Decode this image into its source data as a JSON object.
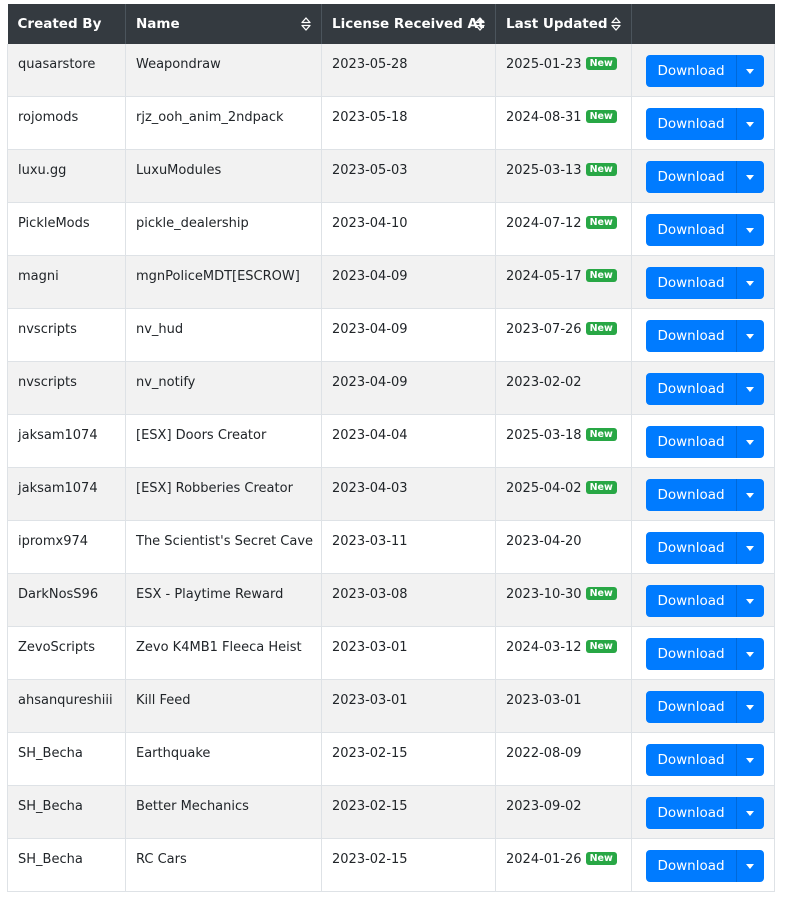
{
  "table": {
    "headers": {
      "created_by": "Created By",
      "name": "Name",
      "license_received_at": "License Received At",
      "last_updated": "Last Updated"
    },
    "new_badge_label": "New",
    "download_label": "Download",
    "rows": [
      {
        "created_by": "quasarstore",
        "name": "Weapondraw",
        "license": "2023-05-28",
        "updated": "2025-01-23",
        "new": true
      },
      {
        "created_by": "rojomods",
        "name": "rjz_ooh_anim_2ndpack",
        "license": "2023-05-18",
        "updated": "2024-08-31",
        "new": true
      },
      {
        "created_by": "luxu.gg",
        "name": "LuxuModules",
        "license": "2023-05-03",
        "updated": "2025-03-13",
        "new": true
      },
      {
        "created_by": "PickleMods",
        "name": "pickle_dealership",
        "license": "2023-04-10",
        "updated": "2024-07-12",
        "new": true
      },
      {
        "created_by": "magni",
        "name": "mgnPoliceMDT[ESCROW]",
        "license": "2023-04-09",
        "updated": "2024-05-17",
        "new": true
      },
      {
        "created_by": "nvscripts",
        "name": "nv_hud",
        "license": "2023-04-09",
        "updated": "2023-07-26",
        "new": true
      },
      {
        "created_by": "nvscripts",
        "name": "nv_notify",
        "license": "2023-04-09",
        "updated": "2023-02-02",
        "new": false
      },
      {
        "created_by": "jaksam1074",
        "name": "[ESX] Doors Creator",
        "license": "2023-04-04",
        "updated": "2025-03-18",
        "new": true
      },
      {
        "created_by": "jaksam1074",
        "name": "[ESX] Robberies Creator",
        "license": "2023-04-03",
        "updated": "2025-04-02",
        "new": true
      },
      {
        "created_by": "ipromx974",
        "name": "The Scientist's Secret Cave",
        "license": "2023-03-11",
        "updated": "2023-04-20",
        "new": false
      },
      {
        "created_by": "DarkNosS96",
        "name": "ESX - Playtime Reward",
        "license": "2023-03-08",
        "updated": "2023-10-30",
        "new": true
      },
      {
        "created_by": "ZevoScripts",
        "name": "Zevo K4MB1 Fleeca Heist",
        "license": "2023-03-01",
        "updated": "2024-03-12",
        "new": true
      },
      {
        "created_by": "ahsanqureshiii",
        "name": "Kill Feed",
        "license": "2023-03-01",
        "updated": "2023-03-01",
        "new": false
      },
      {
        "created_by": "SH_Becha",
        "name": "Earthquake",
        "license": "2023-02-15",
        "updated": "2022-08-09",
        "new": false
      },
      {
        "created_by": "SH_Becha",
        "name": "Better Mechanics",
        "license": "2023-02-15",
        "updated": "2023-09-02",
        "new": false
      },
      {
        "created_by": "SH_Becha",
        "name": "RC Cars",
        "license": "2023-02-15",
        "updated": "2024-01-26",
        "new": true
      }
    ]
  },
  "icons": {
    "sort": "sort-both-icon",
    "caret": "caret-down-icon"
  },
  "colors": {
    "header_bg": "#343a40",
    "primary": "#007bff",
    "badge_new": "#28a745",
    "row_stripe": "#f2f2f2"
  }
}
